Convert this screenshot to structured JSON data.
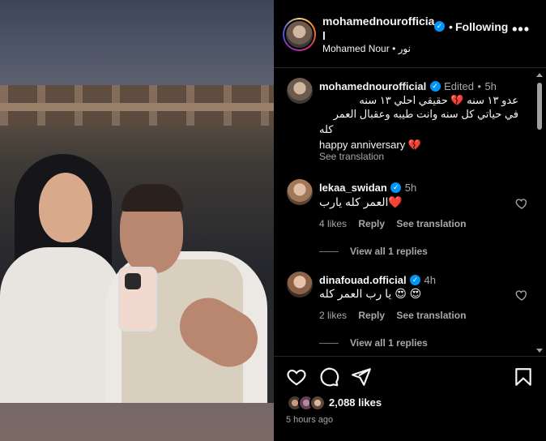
{
  "post_author": {
    "username_line1": "mohamednourofficia",
    "username_line2": "l",
    "verified_mark": "✓",
    "follow_dot": "•",
    "follow_state": "Following",
    "more_label": "•••",
    "display_name": "Mohamed Nour",
    "audio_label": "نور",
    "sub_dot": "•"
  },
  "caption": {
    "username": "mohamednourofficial",
    "verified_mark": "✓",
    "edited": "Edited",
    "dot": "•",
    "age": "5h",
    "line1": "عدو ١٣ سنه 💔 حقيقي احلي ١٣ سنه",
    "line2": "في حياتي كل سنه وانت طيبه وعقبال العمر",
    "line3": "كله",
    "line4": "happy anniversary 💔",
    "translate": "See translation"
  },
  "comments": [
    {
      "username": "lekaa_swidan",
      "verified_mark": "✓",
      "age": "5h",
      "text": "العمر كله يارب❤️",
      "likes": "4 likes",
      "reply": "Reply",
      "translate": "See translation",
      "view_replies": "View all 1 replies"
    },
    {
      "username": "dinafouad.official",
      "verified_mark": "✓",
      "age": "4h",
      "text": "يا رب العمر كله 😍 😍",
      "likes": "2 likes",
      "reply": "Reply",
      "translate": "See translation",
      "view_replies": "View all 1 replies"
    }
  ],
  "footer": {
    "likes": "2,088 likes",
    "time": "5 hours ago"
  },
  "icons": {
    "like": "heart-icon",
    "comment": "comment-icon",
    "share": "paper-plane-icon",
    "save": "bookmark-icon"
  },
  "colors": {
    "verified": "#0095f6",
    "background": "#000000",
    "muted": "#a8a8a8"
  }
}
